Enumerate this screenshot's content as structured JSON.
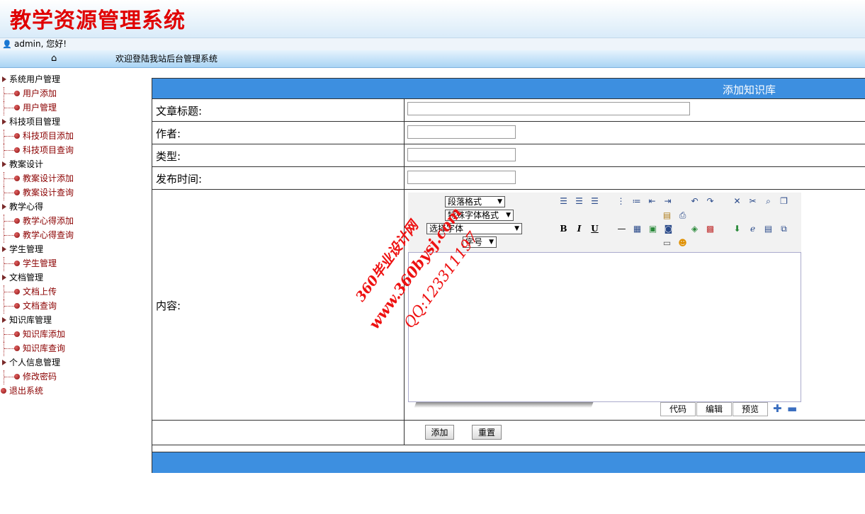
{
  "header": {
    "title": "教学资源管理系统"
  },
  "userbar": {
    "icon": "user-icon",
    "text": "admin, 您好!"
  },
  "navbar": {
    "home_icon": "home-icon",
    "welcome": "欢迎登陆我站后台管理系统"
  },
  "sidebar": {
    "groups": [
      {
        "label": "系统用户管理",
        "items": [
          "用户添加",
          "用户管理"
        ]
      },
      {
        "label": "科技项目管理",
        "items": [
          "科技项目添加",
          "科技项目查询"
        ]
      },
      {
        "label": "教案设计",
        "items": [
          "教案设计添加",
          "教案设计查询"
        ]
      },
      {
        "label": "教学心得",
        "items": [
          "教学心得添加",
          "教学心得查询"
        ]
      },
      {
        "label": "学生管理",
        "items": [
          "学生管理"
        ]
      },
      {
        "label": "文档管理",
        "items": [
          "文档上传",
          "文档查询"
        ]
      },
      {
        "label": "知识库管理",
        "items": [
          "知识库添加",
          "知识库查询"
        ]
      },
      {
        "label": "个人信息管理",
        "items": [
          "修改密码"
        ]
      }
    ],
    "logout": "退出系统"
  },
  "form": {
    "title": "添加知识库",
    "fields": {
      "title_label": "文章标题:",
      "author_label": "作者:",
      "type_label": "类型:",
      "time_label": "发布时间:",
      "content_label": "内容:"
    },
    "values": {
      "title": "",
      "author": "",
      "type": "",
      "time": ""
    },
    "submit_label": "添加",
    "reset_label": "重置"
  },
  "editor": {
    "paragraph_select": "段落格式",
    "special_select": "特殊字体格式",
    "font_select": "选择字体",
    "size_select": "字号",
    "tabs": [
      "代码",
      "编辑",
      "预览"
    ],
    "bold": "B",
    "italic": "I",
    "underline": "U"
  },
  "watermark": {
    "line1": "360毕业设计网",
    "line2": "www.360bysj.com",
    "line3": "QQ:123311197"
  },
  "colors": {
    "title_red": "#e00000",
    "header_blue": "#3d8fe0",
    "link_red": "#8b0000"
  }
}
